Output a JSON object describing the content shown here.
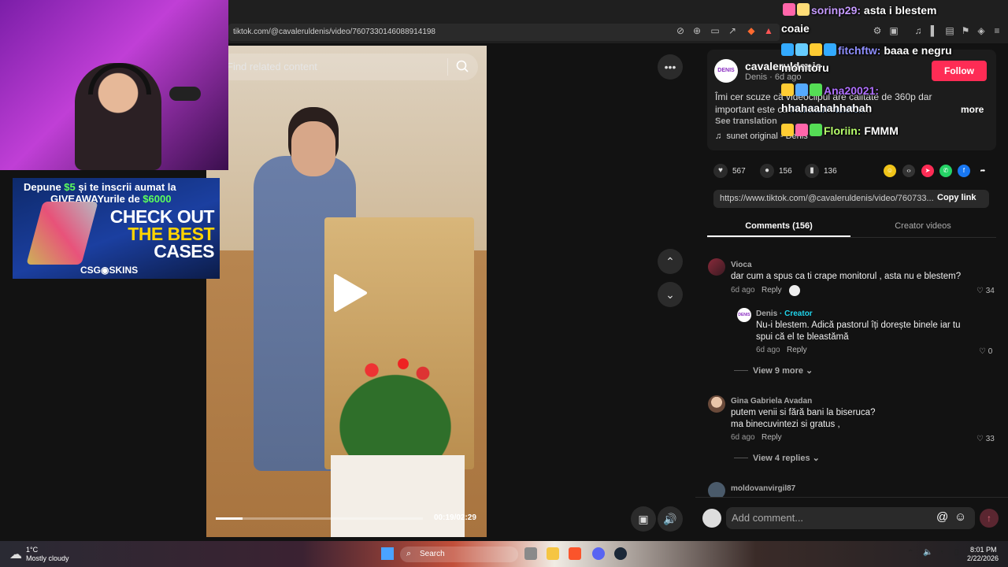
{
  "browser": {
    "url": "tiktok.com/@cavaleruldenis/video/7607330146088914198"
  },
  "ad": {
    "line1_a": "Depune ",
    "line1_amount": "$5",
    "line1_b": " și te inscrii aumat la",
    "line2_a": "GIVEAWAYurile de ",
    "line2_amount": "$6000",
    "check_out": "CHECK OUT",
    "the_best": "THE BEST",
    "cases": "CASES",
    "brand": "CSG◉SKINS"
  },
  "video": {
    "search_placeholder": "Find related content",
    "time": "00:19/02:29",
    "progress": 0.13
  },
  "post": {
    "avatar_text": "DENIS",
    "username": "cavaleruldenis",
    "author_line": "Denis · 6d ago",
    "follow": "Follow",
    "caption_line1": "Îmi cer scuze că videoclipul are calitate de 360p dar",
    "caption_line2_a": "important este că ",
    "caption_line2_tag": "#felicitari #telefon",
    "caption_line2_b": "...",
    "more": "more",
    "see_translation": "See translation",
    "sound": "sunet original - Denis",
    "likes": "567",
    "comments": "156",
    "saves": "136",
    "link": "https://www.tiktok.com/@cavaleruldenis/video/760733...",
    "copy_link": "Copy link"
  },
  "tabs": {
    "comments": "Comments (156)",
    "creator_videos": "Creator videos"
  },
  "comments": [
    {
      "name": "Vioca",
      "text": "dar cum a spus ca ti crape monitorul , asta nu e blestem?",
      "meta": "6d ago",
      "reply": "Reply",
      "likes": "34"
    },
    {
      "name": "Gina Gabriela Avadan",
      "text1": "putem venii si fără bani la biseruca?",
      "text2": "ma binecuvintezi si gratus ,",
      "meta": "6d ago",
      "reply": "Reply",
      "likes": "33",
      "view_more": "View 4 replies"
    },
    {
      "name": "moldovanvirgil87"
    }
  ],
  "creator_reply": {
    "avatar_text": "DENIS",
    "name": "Denis",
    "tag": " · Creator",
    "text1": "Nu-i blestem. Adică pastorul îți dorește binele iar tu",
    "text2": "spui că el te bleastămă",
    "meta": "6d ago",
    "reply": "Reply",
    "likes": "0",
    "view_more": "View 9 more"
  },
  "comment_input": {
    "placeholder": "Add comment..."
  },
  "chat": [
    {
      "user": "sorinp29:",
      "msg": " asta i blestem"
    },
    {
      "user": "",
      "msg": "coaie"
    },
    {
      "user": "fitchftw:",
      "msg": " baaa e negru"
    },
    {
      "user": "",
      "msg": "monitoru"
    },
    {
      "user": "Ana20021:",
      "msg": ""
    },
    {
      "user": "",
      "msg": "hhahaahahhahah"
    },
    {
      "user": "Floriin:",
      "msg": " FMMM"
    }
  ],
  "taskbar": {
    "temp": "1°C",
    "weather": "Mostly cloudy",
    "search": "Search",
    "time": "8:01 PM",
    "date": "2/22/2026"
  },
  "colors": {
    "follow": "#fe2c55",
    "creator": "#20d5ec",
    "tag": "#8fb6e8"
  }
}
